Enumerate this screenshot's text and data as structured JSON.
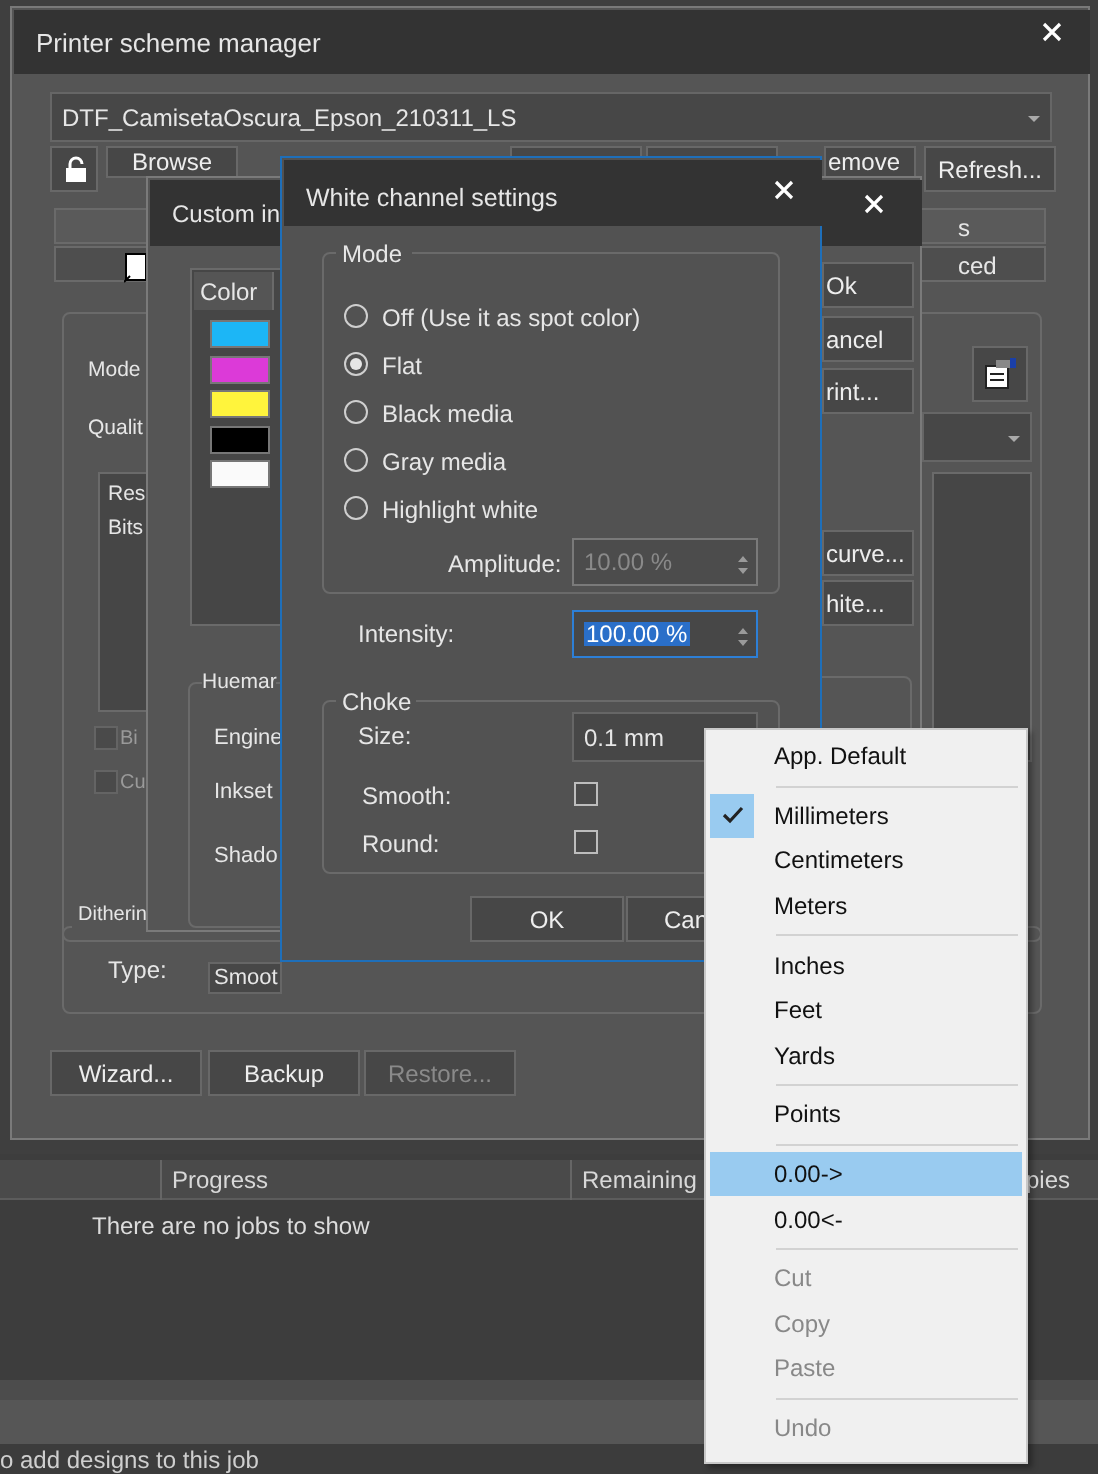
{
  "main_window": {
    "title": "Printer scheme manager",
    "scheme": {
      "value": "DTF_CamisetaOscura_Epson_210311_LS"
    },
    "toolbar_buttons": [
      {
        "label": "Browse"
      },
      {
        "label": "emove"
      },
      {
        "label": "Refresh..."
      }
    ],
    "tab_rows": [
      "s",
      "ced"
    ],
    "settings": {
      "labels": [
        "Mode",
        "Qualit"
      ],
      "list_items": [
        "Res",
        "Bits"
      ],
      "checkboxes": [
        {
          "label": "Bi",
          "checked": false,
          "disabled": true
        },
        {
          "label": "Cu",
          "checked": false,
          "disabled": true
        }
      ]
    },
    "dithering": {
      "title": "Ditherin",
      "type_label": "Type:",
      "type_value": "Smoot"
    },
    "bottom_buttons": [
      {
        "label": "Wizard...",
        "disabled": false
      },
      {
        "label": "Backup",
        "disabled": false
      },
      {
        "label": "Restore...",
        "disabled": true
      }
    ]
  },
  "custom_ink_window": {
    "title": "Custom in",
    "color_header": "Color",
    "colors": [
      {
        "color": "#1cb6f6"
      },
      {
        "color": "#dc3ad8"
      },
      {
        "color": "#fff43c"
      },
      {
        "color": "#000000"
      },
      {
        "color": "#fafafa"
      }
    ],
    "buttons": [
      "Ok",
      "ancel",
      "rint...",
      "curve...",
      "hite..."
    ],
    "group_title": "Huemar",
    "labels": [
      "Engine",
      "Inkset",
      "Shado"
    ]
  },
  "white_channel_dialog": {
    "title": "White channel settings",
    "mode_title": "Mode",
    "modes": [
      {
        "label": "Off (Use it as spot color)",
        "selected": false
      },
      {
        "label": "Flat",
        "selected": true
      },
      {
        "label": "Black media",
        "selected": false
      },
      {
        "label": "Gray media",
        "selected": false
      },
      {
        "label": "Highlight white",
        "selected": false
      }
    ],
    "amplitude": {
      "label": "Amplitude:",
      "value": "10.00 %",
      "disabled": true
    },
    "intensity": {
      "label": "Intensity:",
      "value": "100.00 %",
      "focused": true
    },
    "choke": {
      "title": "Choke",
      "size_label": "Size:",
      "size_value": "0.1 mm",
      "options": [
        {
          "label": "Smooth:",
          "checked": false
        },
        {
          "label": "Round:",
          "checked": false
        }
      ]
    },
    "buttons": [
      "OK",
      "Can"
    ]
  },
  "context_menu": {
    "groups": [
      [
        {
          "label": "App. Default",
          "checked": false,
          "highlighted": false,
          "disabled": false
        }
      ],
      [
        {
          "label": "Millimeters",
          "checked": true,
          "highlighted": false,
          "disabled": false
        },
        {
          "label": "Centimeters",
          "checked": false,
          "highlighted": false,
          "disabled": false
        },
        {
          "label": "Meters",
          "checked": false,
          "highlighted": false,
          "disabled": false
        }
      ],
      [
        {
          "label": "Inches",
          "checked": false,
          "highlighted": false,
          "disabled": false
        },
        {
          "label": "Feet",
          "checked": false,
          "highlighted": false,
          "disabled": false
        },
        {
          "label": "Yards",
          "checked": false,
          "highlighted": false,
          "disabled": false
        }
      ],
      [
        {
          "label": "Points",
          "checked": false,
          "highlighted": false,
          "disabled": false
        }
      ],
      [
        {
          "label": "0.00->",
          "checked": false,
          "highlighted": true,
          "disabled": false
        },
        {
          "label": "0.00<-",
          "checked": false,
          "highlighted": false,
          "disabled": false
        }
      ],
      [
        {
          "label": "Cut",
          "checked": false,
          "highlighted": false,
          "disabled": true
        },
        {
          "label": "Copy",
          "checked": false,
          "highlighted": false,
          "disabled": true
        },
        {
          "label": "Paste",
          "checked": false,
          "highlighted": false,
          "disabled": true
        }
      ],
      [
        {
          "label": "Undo",
          "checked": false,
          "highlighted": false,
          "disabled": true
        }
      ]
    ]
  },
  "job_list": {
    "columns": [
      "Progress",
      "Remaining",
      "pies"
    ],
    "empty_message": "There are no jobs to show"
  },
  "status_bar": "o add designs to this job"
}
